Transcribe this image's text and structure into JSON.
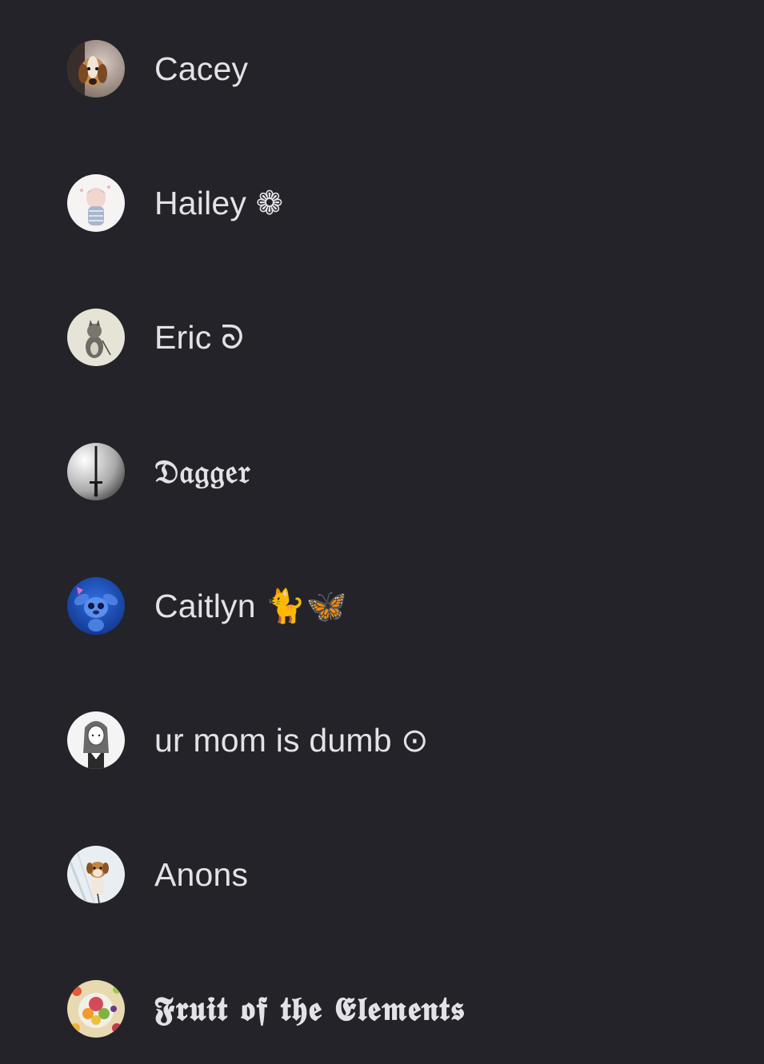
{
  "contacts": [
    {
      "name": "Cacey",
      "avatar": "beagle-dog-photo"
    },
    {
      "name": "Hailey ❁",
      "avatar": "anime-girl-drawing"
    },
    {
      "name": "Eric ᘐ",
      "avatar": "cat-figure-drawing"
    },
    {
      "name": "𝔇𝔞𝔤𝔤𝔢𝔯",
      "avatar": "dagger-sword"
    },
    {
      "name": "Caitlyn 🐈🦋",
      "avatar": "stitch-character"
    },
    {
      "name": "ur mom is dumb ⊙",
      "avatar": "anime-character-sketch"
    },
    {
      "name": "Anons",
      "avatar": "puppy-photo"
    },
    {
      "name": "𝕱𝖗𝖚𝖎𝖙 𝖔𝖋 𝖙𝖍𝖊 𝕰𝖑𝖊𝖒𝖊𝖓𝖙𝖘",
      "avatar": "fruit-bowl-photo"
    }
  ]
}
